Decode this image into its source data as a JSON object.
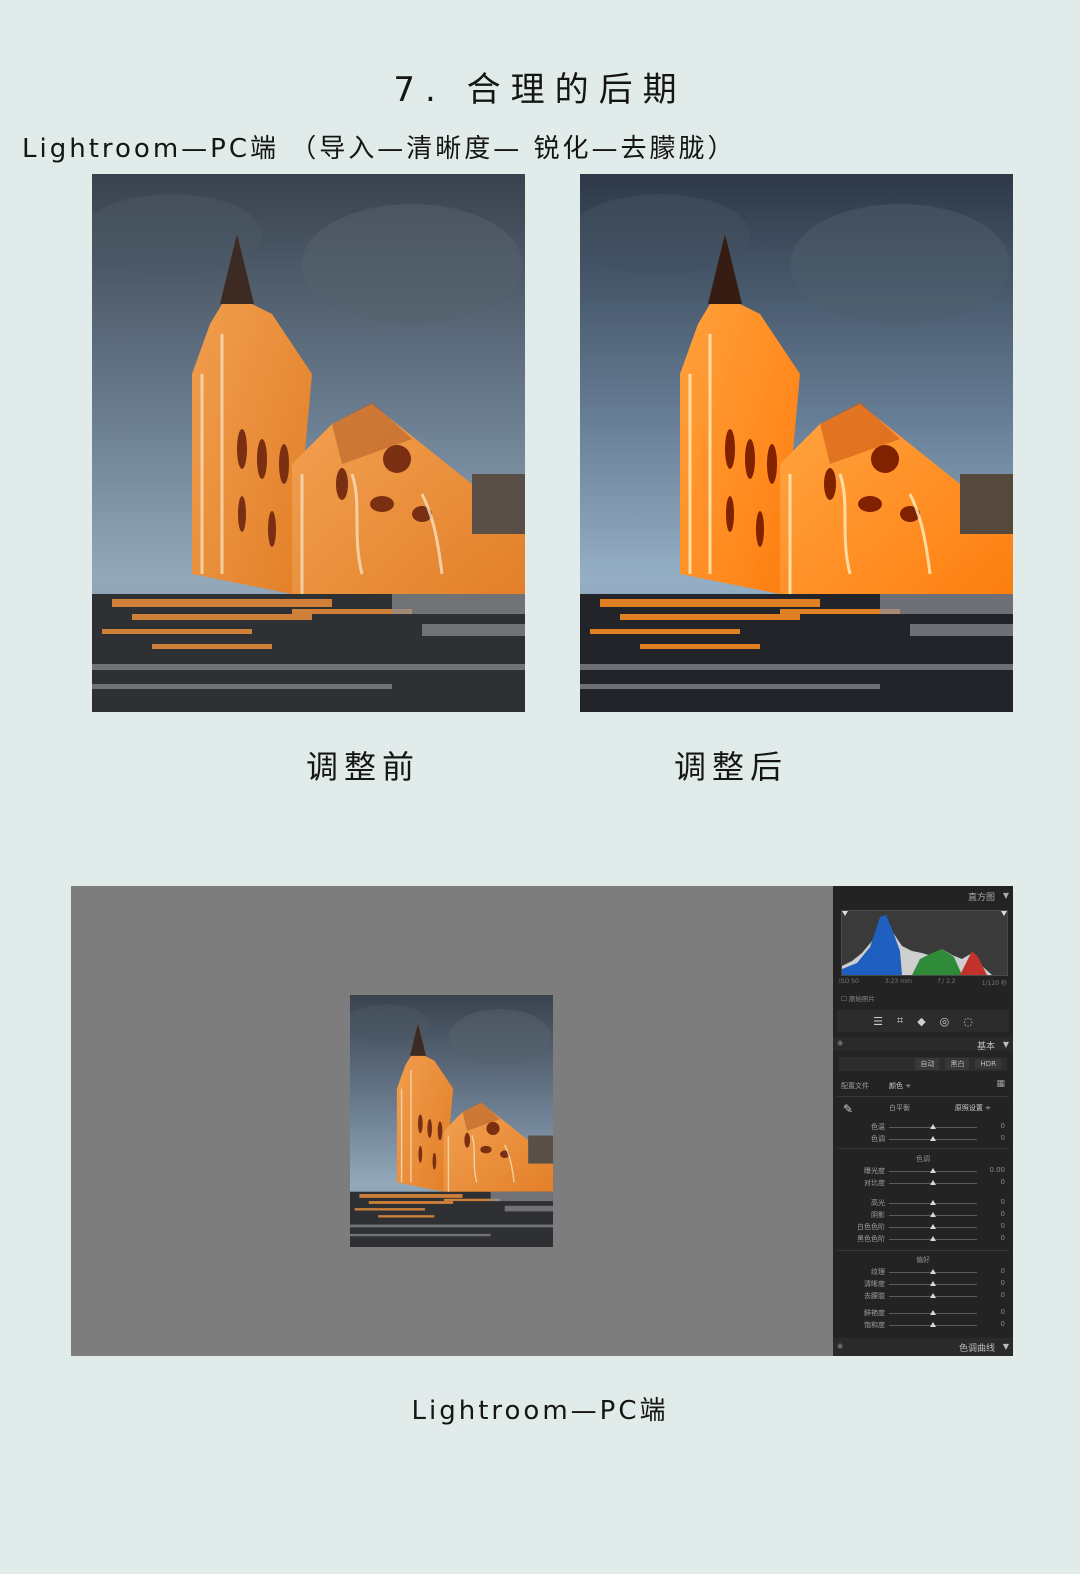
{
  "page": {
    "title": "7. 合理的后期",
    "subtitle": "Lightroom—PC端 （导入—清晰度— 锐化—去朦胧）",
    "before_caption": "调整前",
    "after_caption": "调整后",
    "bottom_caption": "Lightroom—PC端"
  },
  "lightroom": {
    "histogram_label": "直方图",
    "meta": [
      "ISO 50",
      "3.23 mm",
      "f / 2.2",
      "1/120 秒"
    ],
    "original_photo": "原始照片",
    "tools": [
      "sliders-icon",
      "crop-icon",
      "eraser-icon",
      "redeye-icon",
      "mask-icon"
    ],
    "basic_label": "基本",
    "auto_buttons": [
      "自动",
      "黑白",
      "HDR"
    ],
    "profile_label": "配置文件",
    "profile_value": "颜色 ÷",
    "wb_label": "白平衡",
    "wb_value": "原照设置 ÷",
    "wb_rows": [
      {
        "label": "色温",
        "value": "0"
      },
      {
        "label": "色调",
        "value": "0"
      }
    ],
    "tone_group": "色调",
    "tone_rows": [
      {
        "label": "曝光度",
        "value": "0.00"
      },
      {
        "label": "对比度",
        "value": "0"
      },
      {
        "label": "高光",
        "value": "0"
      },
      {
        "label": "阴影",
        "value": "0"
      },
      {
        "label": "白色色阶",
        "value": "0"
      },
      {
        "label": "黑色色阶",
        "value": "0"
      }
    ],
    "presence_group": "偏好",
    "presence_rows": [
      {
        "label": "纹理",
        "value": "0"
      },
      {
        "label": "清晰度",
        "value": "0"
      },
      {
        "label": "去朦胧",
        "value": "0"
      },
      {
        "label": "鲜艳度",
        "value": "0"
      },
      {
        "label": "饱和度",
        "value": "0"
      }
    ],
    "tone_curve_label": "色调曲线",
    "colors": {
      "panel": "#232323",
      "canvas": "#7d7d7d",
      "hist_blue": "#1e5fbf",
      "hist_green": "#2f8b3a",
      "hist_red": "#c0322b"
    }
  }
}
